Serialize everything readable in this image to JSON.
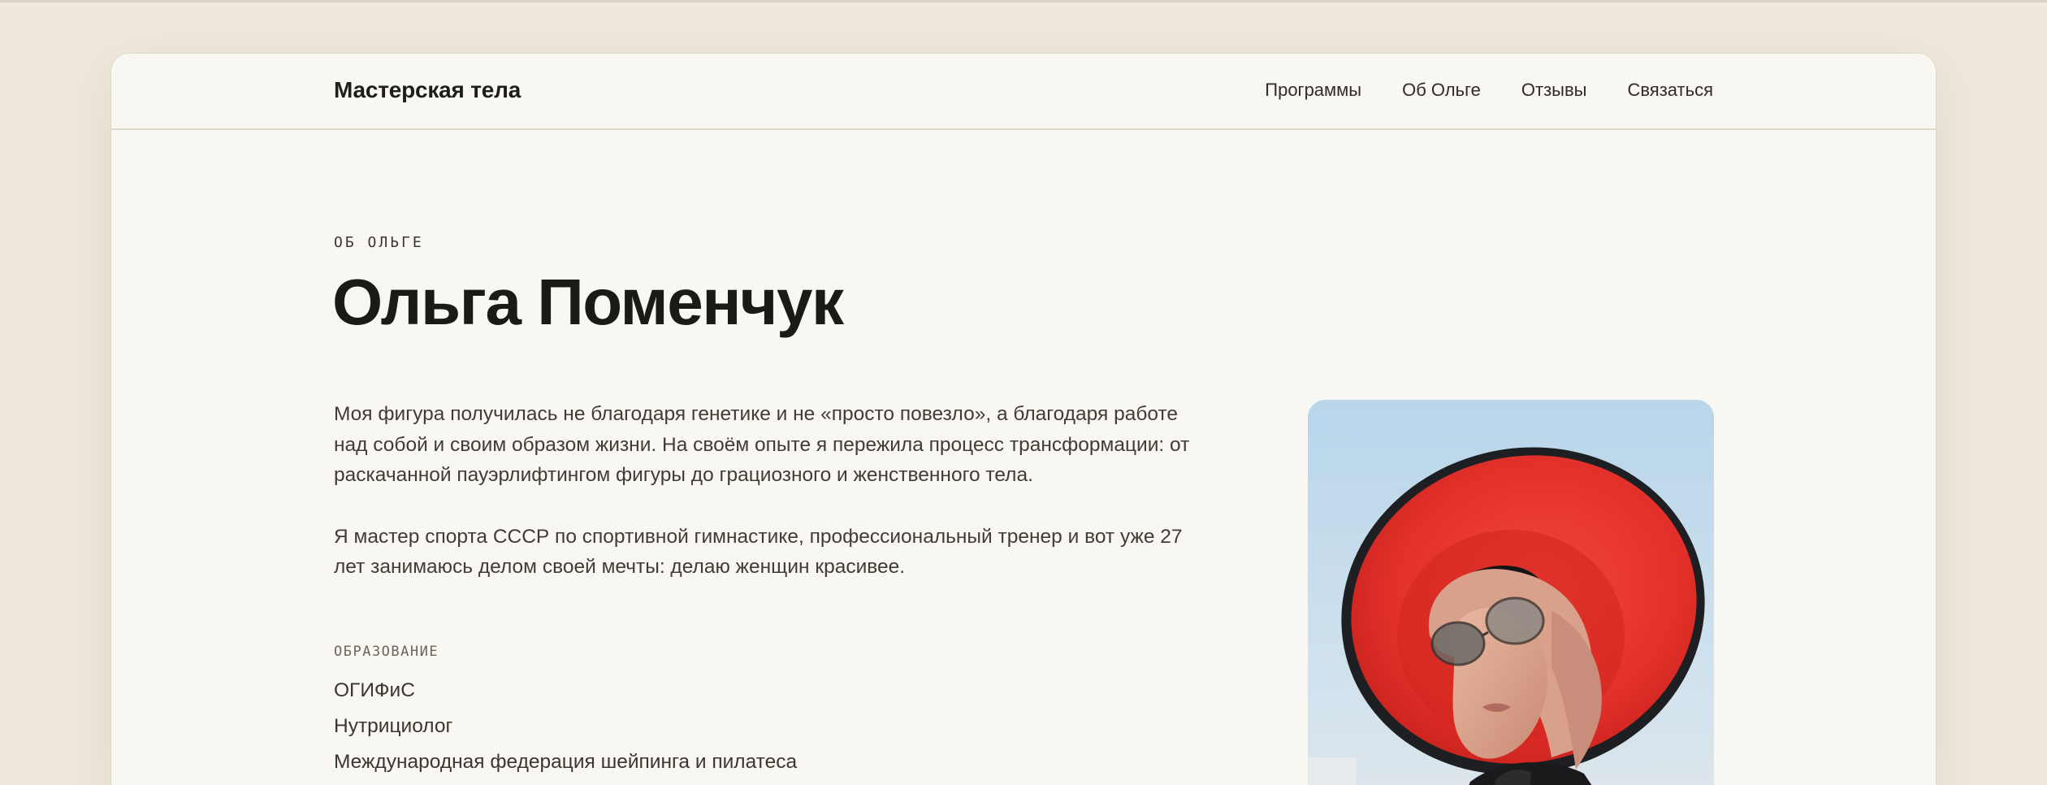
{
  "header": {
    "brand": "Мастерская тела",
    "nav": [
      {
        "label": "Программы"
      },
      {
        "label": "Об Ольге"
      },
      {
        "label": "Отзывы"
      },
      {
        "label": "Связаться"
      }
    ]
  },
  "about": {
    "eyebrow": "ОБ ОЛЬГЕ",
    "title": "Ольга Поменчук",
    "paragraphs": [
      "Моя фигура получилась не благодаря генетике и не «просто повезло», а благодаря работе над собой и своим образом жизни. На своём опыте я пережила процесс трансформации: от раскачанной пауэрлифтингом фигуры до грациозного и женственного тела.",
      "Я мастер спорта СССР по спортивной гимнастике, профессиональный тренер и вот уже 27 лет занимаюсь делом своей мечты: делаю женщин красивее."
    ],
    "education_label": "ОБРАЗОВАНИЕ",
    "education": [
      "ОГИФиС",
      "Нутрициолог",
      "Международная федерация шейпинга и пилатеса"
    ]
  },
  "colors": {
    "background": "#eee8dd",
    "card": "#f9f7f2",
    "text": "#1c1a17",
    "hat_red": "#e8302a"
  }
}
